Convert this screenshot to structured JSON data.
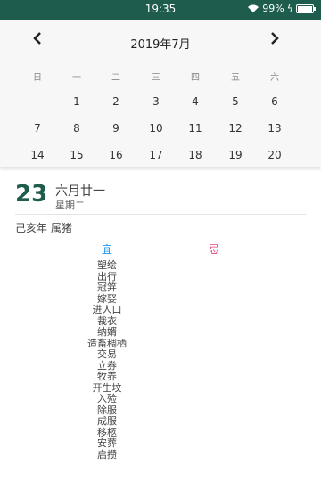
{
  "status_bar": {
    "time": "19:35",
    "battery": "99%"
  },
  "calendar": {
    "title": "2019年7月",
    "weekdays": [
      "日",
      "一",
      "二",
      "三",
      "四",
      "五",
      "六"
    ],
    "days": [
      [
        "",
        "1",
        "2",
        "3",
        "4",
        "5",
        "6"
      ],
      [
        "7",
        "8",
        "9",
        "10",
        "11",
        "12",
        "13"
      ],
      [
        "14",
        "15",
        "16",
        "17",
        "18",
        "19",
        "20"
      ]
    ]
  },
  "detail": {
    "day": "23",
    "lunar_date": "六月廿一",
    "weekday": "星期二",
    "year_zodiac": "己亥年  属猪",
    "yi_label": "宜",
    "ji_label": "忌",
    "yi_items": [
      "塑绘",
      "出行",
      "冠笄",
      "嫁娶",
      "进人口",
      "裁衣",
      "纳婿",
      "造畜稠栖",
      "交易",
      "立券",
      "牧养",
      "开生坟",
      "入殓",
      "除服",
      "成服",
      "移柩",
      "安葬",
      "启攒"
    ]
  }
}
